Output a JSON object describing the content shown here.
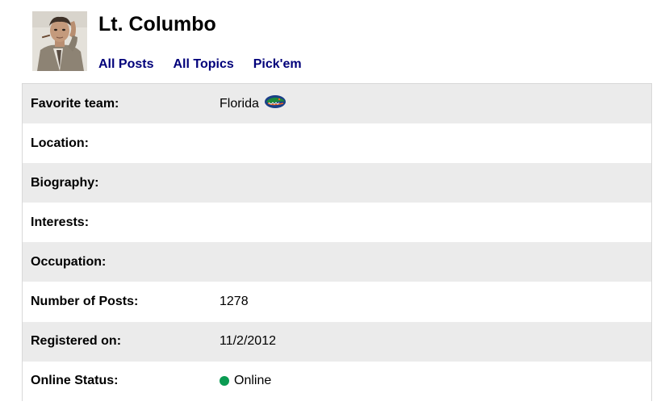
{
  "profile": {
    "name": "Lt. Columbo",
    "avatar": "columbo-photo"
  },
  "nav": {
    "all_posts": "All Posts",
    "all_topics": "All Topics",
    "pickem": "Pick'em"
  },
  "details": {
    "favorite_team_label": "Favorite team:",
    "favorite_team_value": "Florida",
    "favorite_team_icon": "florida-gator-logo",
    "location_label": "Location:",
    "location_value": "",
    "biography_label": "Biography:",
    "biography_value": "",
    "interests_label": "Interests:",
    "interests_value": "",
    "occupation_label": "Occupation:",
    "occupation_value": "",
    "posts_label": "Number of Posts:",
    "posts_value": "1278",
    "registered_label": "Registered on:",
    "registered_value": "11/2/2012",
    "status_label": "Online Status:",
    "status_value": "Online",
    "status_color": "#0a9b52"
  },
  "colors": {
    "link": "#00007a",
    "row_alt": "#ebebeb",
    "border": "#d8d8d8"
  }
}
